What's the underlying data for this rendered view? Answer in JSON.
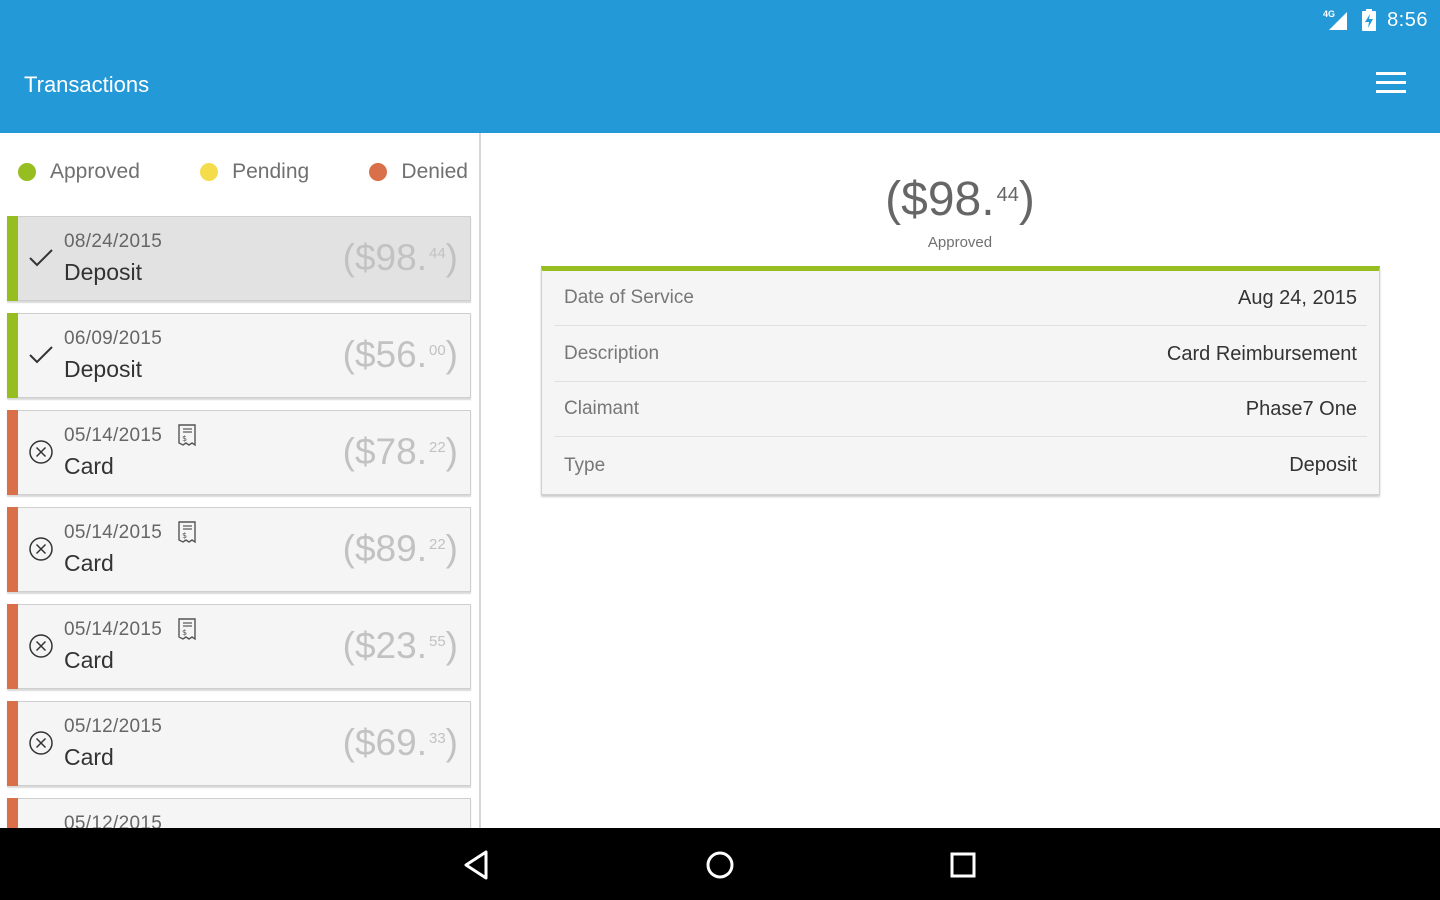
{
  "status_bar": {
    "network": "4G",
    "time": "8:56"
  },
  "app_bar": {
    "title": "Transactions"
  },
  "legend": [
    {
      "label": "Approved",
      "color": "#97be20"
    },
    {
      "label": "Pending",
      "color": "#f5dc4b"
    },
    {
      "label": "Denied",
      "color": "#d9704a"
    }
  ],
  "transactions": [
    {
      "date": "08/24/2015",
      "type": "Deposit",
      "amount_main": "($98.",
      "amount_cents": "44",
      "amount_close": ")",
      "status": "approved",
      "receipt": false,
      "selected": true
    },
    {
      "date": "06/09/2015",
      "type": "Deposit",
      "amount_main": "($56.",
      "amount_cents": "00",
      "amount_close": ")",
      "status": "approved",
      "receipt": false,
      "selected": false
    },
    {
      "date": "05/14/2015",
      "type": "Card",
      "amount_main": "($78.",
      "amount_cents": "22",
      "amount_close": ")",
      "status": "denied",
      "receipt": true,
      "selected": false
    },
    {
      "date": "05/14/2015",
      "type": "Card",
      "amount_main": "($89.",
      "amount_cents": "22",
      "amount_close": ")",
      "status": "denied",
      "receipt": true,
      "selected": false
    },
    {
      "date": "05/14/2015",
      "type": "Card",
      "amount_main": "($23.",
      "amount_cents": "55",
      "amount_close": ")",
      "status": "denied",
      "receipt": true,
      "selected": false
    },
    {
      "date": "05/12/2015",
      "type": "Card",
      "amount_main": "($69.",
      "amount_cents": "33",
      "amount_close": ")",
      "status": "denied",
      "receipt": false,
      "selected": false
    },
    {
      "date": "05/12/2015",
      "type": "",
      "amount_main": "",
      "amount_cents": "",
      "amount_close": "",
      "status": "denied",
      "receipt": false,
      "selected": false
    }
  ],
  "detail": {
    "amount_main": "($98.",
    "amount_cents": "44",
    "amount_close": ")",
    "status_label": "Approved",
    "rows": [
      {
        "label": "Date of Service",
        "value": "Aug 24, 2015"
      },
      {
        "label": "Description",
        "value": "Card Reimbursement"
      },
      {
        "label": "Claimant",
        "value": "Phase7 One"
      },
      {
        "label": "Type",
        "value": "Deposit"
      }
    ]
  },
  "colors": {
    "app_bar": "#2499d8",
    "approved": "#97be20",
    "pending": "#f5dc4b",
    "denied": "#d9704a"
  }
}
